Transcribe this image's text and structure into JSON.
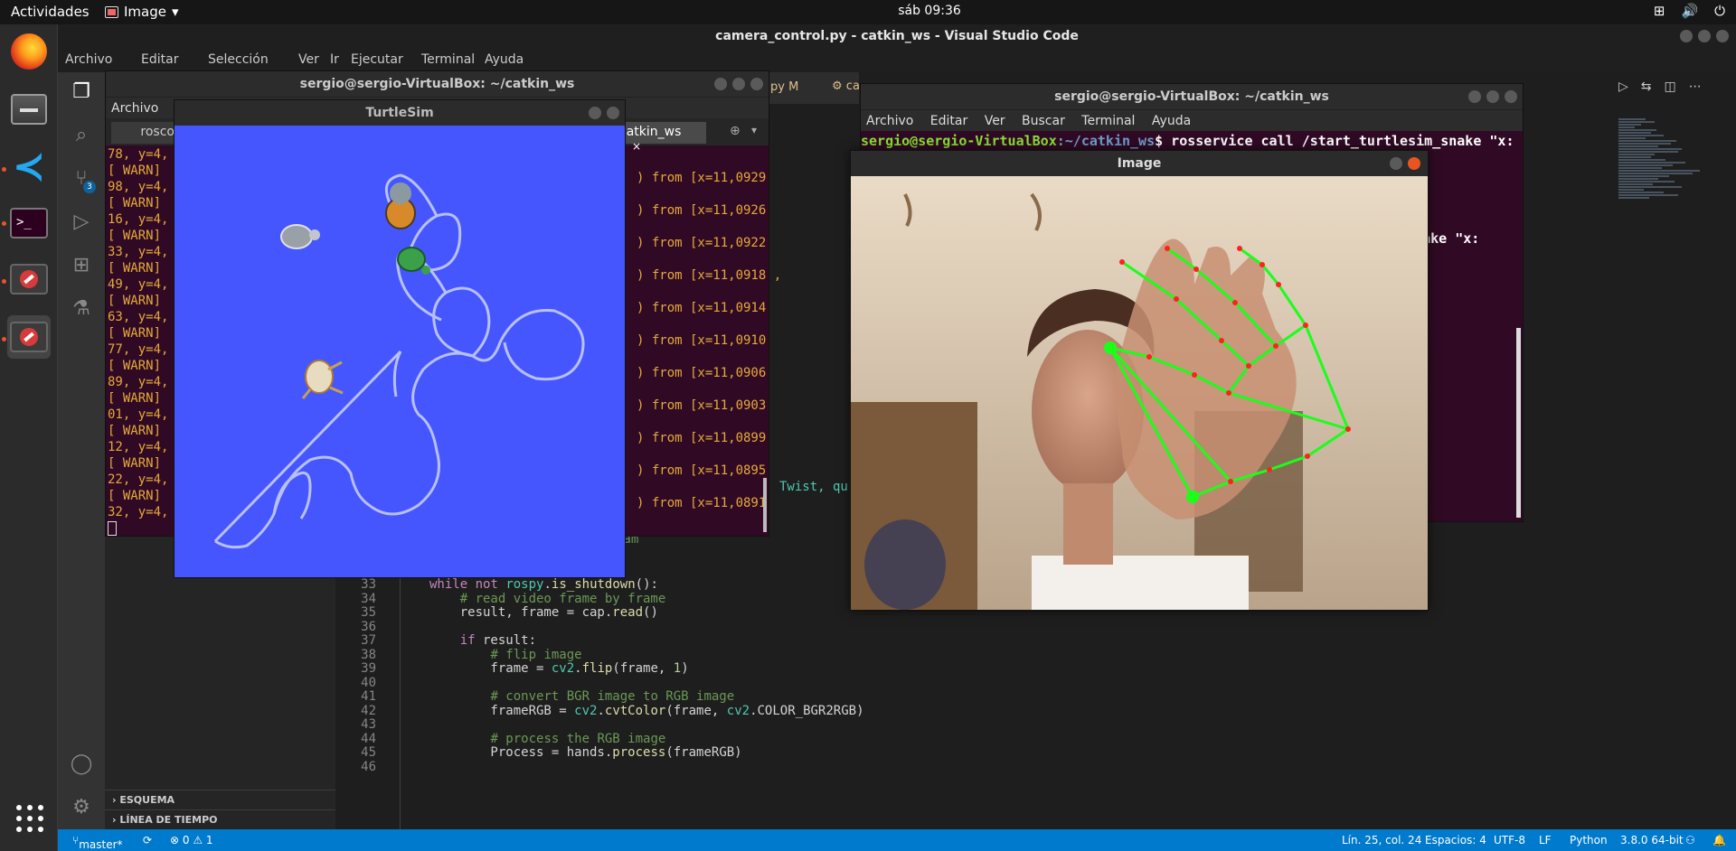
{
  "topbar": {
    "activities": "Actividades",
    "app_name": "Image",
    "clock": "sáb 09:36"
  },
  "vscode": {
    "title": "camera_control.py - catkin_ws - Visual Studio Code",
    "menu": [
      "Archivo",
      "Editar",
      "Selección",
      "Ver",
      "Ir",
      "Ejecutar",
      "Terminal",
      "Ayuda"
    ],
    "tab_partial": "py M",
    "tab_partial2": "ca",
    "sidebar_sections": [
      "ESQUEMA",
      "LÍNEA DE TIEMPO"
    ],
    "code_lines": [
      {
        "n": "33",
        "text": "while not rospy.is_shutdown():"
      },
      {
        "n": "34",
        "text": "    # read video frame by frame"
      },
      {
        "n": "35",
        "text": "    result, frame = cap.read()"
      },
      {
        "n": "36",
        "text": ""
      },
      {
        "n": "37",
        "text": "    if result:"
      },
      {
        "n": "38",
        "text": "        # flip image"
      },
      {
        "n": "39",
        "text": "        frame = cv2.flip(frame, 1)"
      },
      {
        "n": "40",
        "text": ""
      },
      {
        "n": "41",
        "text": "        # convert BGR image to RGB image"
      },
      {
        "n": "42",
        "text": "        frameRGB = cv2.cvtColor(frame, cv2.COLOR_BGR2RGB)"
      },
      {
        "n": "43",
        "text": ""
      },
      {
        "n": "44",
        "text": "        # process the RGB image"
      },
      {
        "n": "45",
        "text": "        Process = hands.process(frameRGB)"
      },
      {
        "n": "46",
        "text": ""
      }
    ],
    "code_partial_above": "rom webcam",
    "code_partial_twist": "Twist, qu",
    "statusbar": {
      "branch": "master*",
      "problems": "⊗ 0 ⚠ 1",
      "position": "Lín. 25, col. 24",
      "spaces": "Espacios: 4",
      "encoding": "UTF-8",
      "eol": "LF",
      "language": "Python",
      "interpreter": "3.8.0 64-bit"
    }
  },
  "terminal1": {
    "title": "sergio@sergio-VirtualBox: ~/catkin_ws",
    "menu_first": "Archivo",
    "menu_partial": "E",
    "tab_left": "rosco",
    "tab_right": "catkin_ws",
    "lines": [
      "78, y=4,",
      "[ WARN]",
      "98, y=4,",
      "[ WARN]",
      "16, y=4,",
      "[ WARN]",
      "33, y=4,",
      "[ WARN]",
      "49, y=4,",
      "[ WARN]",
      "63, y=4,",
      "[ WARN]",
      "77, y=4,",
      "[ WARN]",
      "89, y=4,",
      "[ WARN]",
      "01, y=4,",
      "[ WARN]",
      "12, y=4,",
      "[ WARN]",
      "22, y=4,",
      "[ WARN]",
      "32, y=4,"
    ],
    "right_lines": [
      ") from [x=11,0929",
      ") from [x=11,0926",
      ") from [x=11,0922",
      ") from [x=11,0918 ,",
      ") from [x=11,0914",
      ") from [x=11,0910",
      ") from [x=11,0906",
      ") from [x=11,0903",
      ") from [x=11,0899",
      ") from [x=11,0895",
      ") from [x=11,0891"
    ]
  },
  "turtlesim": {
    "title": "TurtleSim",
    "background": "#4556ff"
  },
  "terminal2": {
    "title": "sergio@sergio-VirtualBox: ~/catkin_ws",
    "menu": [
      "Archivo",
      "Editar",
      "Ver",
      "Buscar",
      "Terminal",
      "Ayuda"
    ],
    "prompt_user": "sergio@sergio-VirtualBox",
    "prompt_path": ":~/catkin_ws",
    "command": "$ rosservice call /start_turtlesim_snake \"x:",
    "partial_line": "_snake \"x:"
  },
  "imagewin": {
    "title": "Image"
  }
}
